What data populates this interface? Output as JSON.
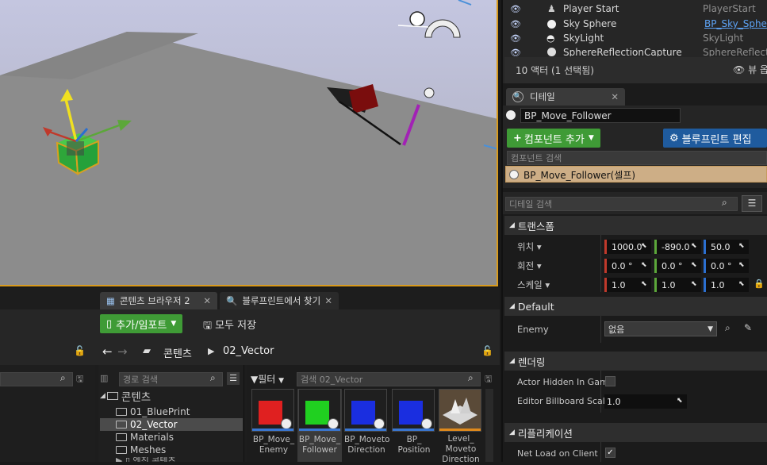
{
  "outliner": {
    "rows": [
      {
        "name": "Player Start",
        "type": "PlayerStart",
        "icon": "player-start-icon"
      },
      {
        "name": "Sky Sphere",
        "type": "BP_Sky_Sphe",
        "icon": "sphere-icon"
      },
      {
        "name": "SkyLight",
        "type": "SkyLight",
        "icon": "skylight-icon"
      },
      {
        "name": "SphereReflectionCapture",
        "type": "SphereReflection",
        "icon": "reflection-icon"
      }
    ],
    "status": "10 액터 (1 선택됨)",
    "view_label": "뷰 옵"
  },
  "details": {
    "tab_label": "디테일",
    "object_name": "BP_Move_Follower",
    "add_component_label": "컴포넌트 추가",
    "blueprint_edit_label": "블루프린트 편집",
    "component_search_placeholder": "컴포넌트 검색",
    "self_component": "BP_Move_Follower(셀프)",
    "details_search_placeholder": "디테일 검색",
    "transform": {
      "title": "트랜스폼",
      "location_label": "위치",
      "rotation_label": "회전",
      "scale_label": "스케일",
      "location": [
        "1000.0",
        "-890.0",
        "50.0"
      ],
      "rotation": [
        "0.0 °",
        "0.0 °",
        "0.0 °"
      ],
      "scale": [
        "1.0",
        "1.0",
        "1.0"
      ]
    },
    "default": {
      "title": "Default",
      "enemy_label": "Enemy",
      "enemy_value": "없음"
    },
    "rendering": {
      "title": "렌더링",
      "actor_hidden_label": "Actor Hidden In Game",
      "actor_hidden_checked": false,
      "billboard_label": "Editor Billboard Scale",
      "billboard_value": "1.0"
    },
    "replication": {
      "title": "리플리케이션",
      "net_load_label": "Net Load on Client",
      "net_load_checked": true
    }
  },
  "content_browser": {
    "tab1": "콘텐츠 브라우저 2",
    "tab2": "블루프린트에서 찾기",
    "add_import_label": "추가/임포트",
    "save_all_label": "모두 저장",
    "path_root": "콘텐츠",
    "path_current": "02_Vector",
    "path_search_placeholder": "경로 검색",
    "filter_label": "필터",
    "search_placeholder": "검색 02_Vector",
    "tree": [
      {
        "label": "콘텐츠",
        "level": 0
      },
      {
        "label": "01_BluePrint",
        "level": 1
      },
      {
        "label": "02_Vector",
        "level": 1,
        "selected": true
      },
      {
        "label": "Materials",
        "level": 1
      },
      {
        "label": "Meshes",
        "level": 1
      }
    ],
    "assets": [
      {
        "line1": "BP_Move_",
        "line2": "Enemy",
        "color": "#e02020"
      },
      {
        "line1": "BP_Move_",
        "line2": "Follower",
        "color": "#20d020"
      },
      {
        "line1": "BP_Moveto",
        "line2": "Direction",
        "color": "#1a2ee0"
      },
      {
        "line1": "BP_",
        "line2": "Position",
        "color": "#1a2ee0"
      },
      {
        "line1": "Level_",
        "line2": "Moveto",
        "line3": "Direction",
        "color": "#8a7a62"
      }
    ]
  },
  "colors": {
    "accent_orange": "#d89a1c",
    "green_button": "#3f9b36",
    "blue_button": "#1f5b9e",
    "x_axis": "#c0392b",
    "y_axis": "#5ca73a",
    "z_axis": "#2b6fd0"
  }
}
